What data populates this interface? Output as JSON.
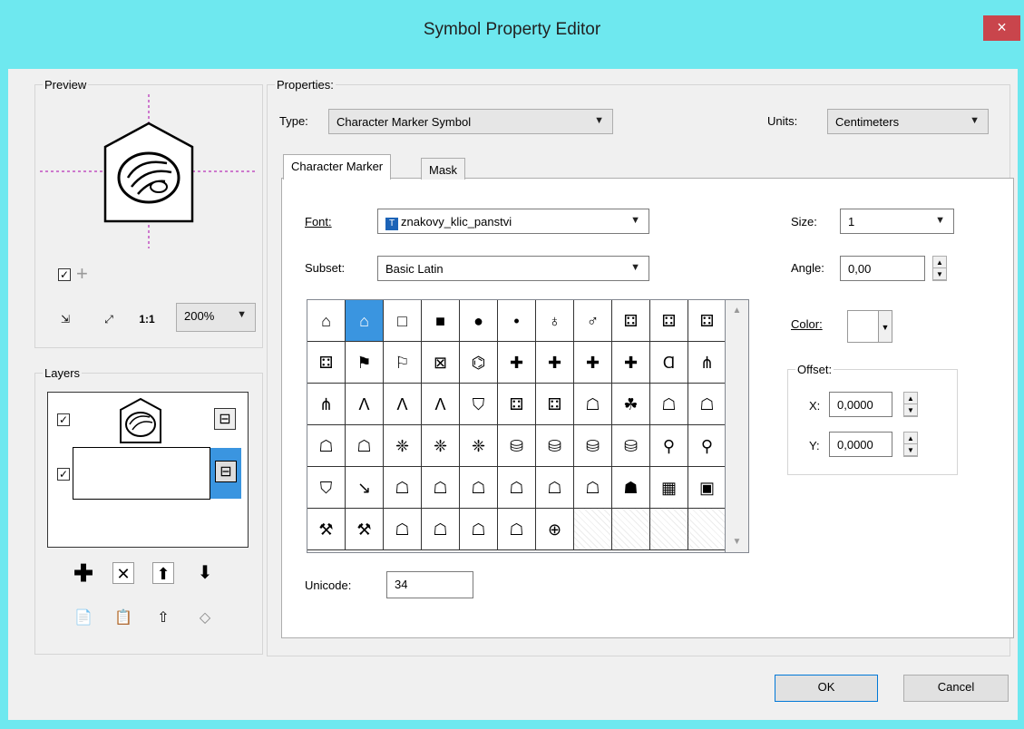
{
  "window": {
    "title": "Symbol Property Editor",
    "close_glyph": "×"
  },
  "preview": {
    "legend": "Preview",
    "zoom": "200%",
    "tools": [
      "zoom-fit-icon",
      "zoom-extent-icon",
      "zoom-actual-icon"
    ]
  },
  "layers": {
    "legend": "Layers",
    "actions": [
      "add-layer-icon",
      "delete-layer-icon",
      "move-up-icon",
      "move-down-icon"
    ],
    "clipboard": [
      "copy-icon",
      "paste-icon",
      "restore-icon",
      "tag-icon"
    ]
  },
  "properties": {
    "legend": "Properties:",
    "type_label": "Type:",
    "type_value": "Character Marker Symbol",
    "units_label": "Units:",
    "units_value": "Centimeters"
  },
  "tabs": [
    {
      "label": "Character Marker"
    },
    {
      "label": "Mask"
    }
  ],
  "marker": {
    "font_label": "Font:",
    "font_value": "znakovy_klic_panstvi",
    "subset_label": "Subset:",
    "subset_value": "Basic Latin",
    "unicode_label": "Unicode:",
    "unicode_value": "34",
    "size_label": "Size:",
    "size_value": "1",
    "angle_label": "Angle:",
    "angle_value": "0,00",
    "color_label": "Color:",
    "offset_legend": "Offset:",
    "x_label": "X:",
    "x_value": "0,0000",
    "y_label": "Y:",
    "y_value": "0,0000",
    "selected_index": 1
  },
  "buttons": {
    "ok": "OK",
    "cancel": "Cancel"
  }
}
